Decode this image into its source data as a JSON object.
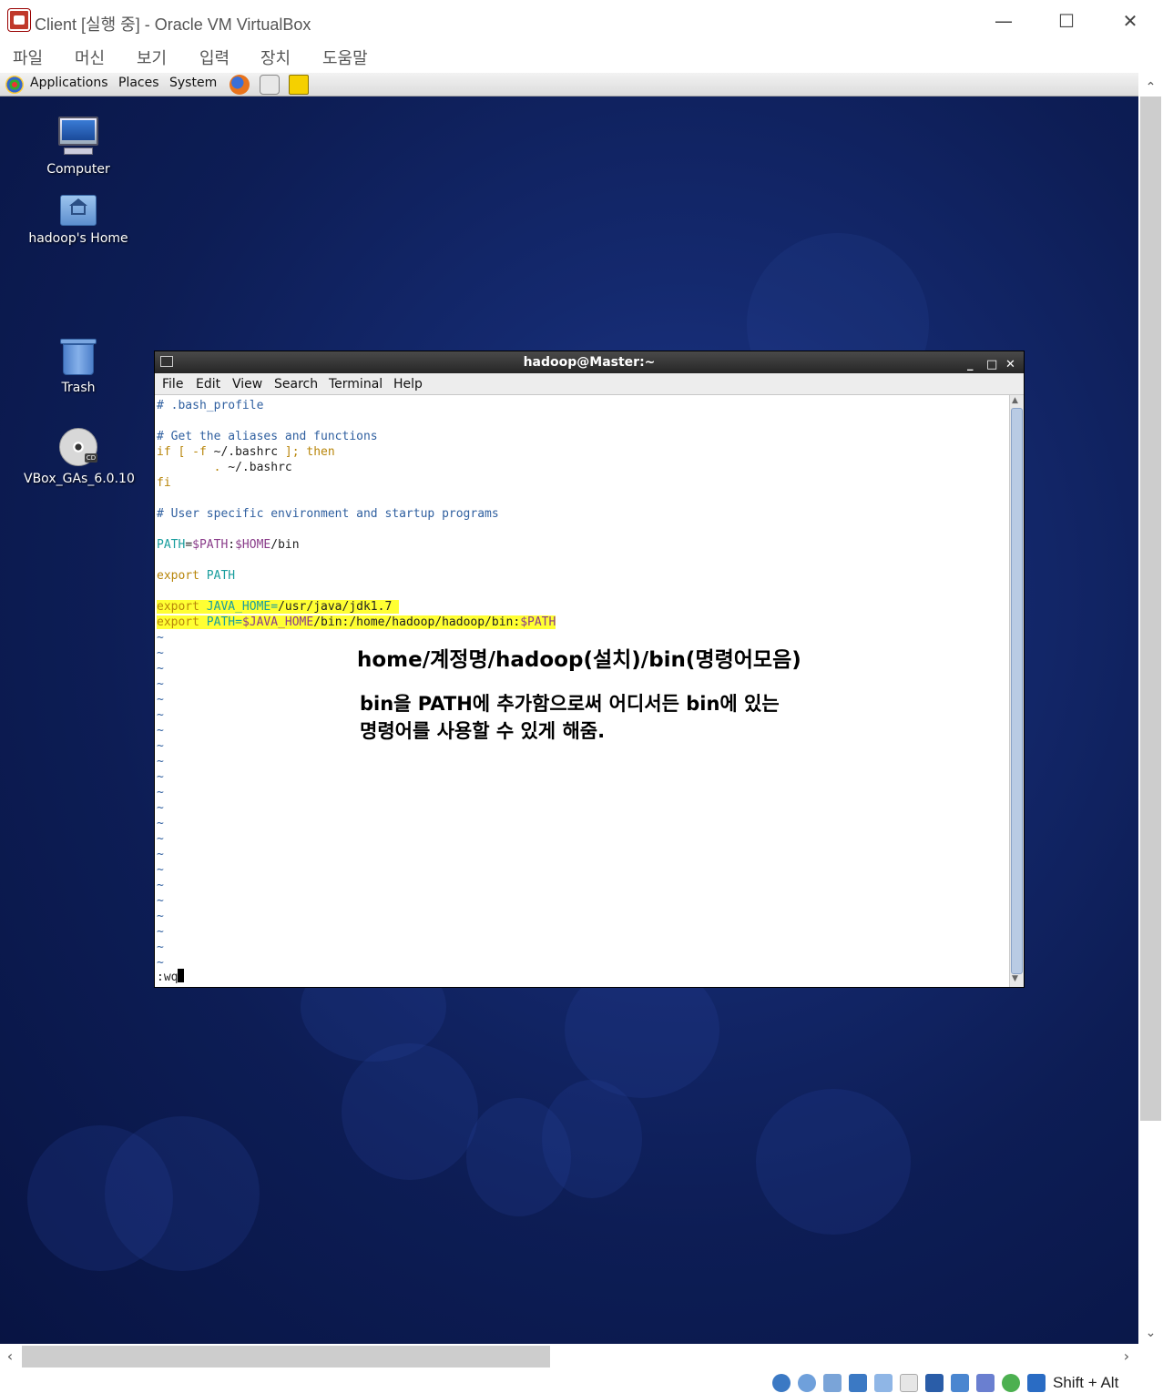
{
  "host": {
    "title": "Client [실행 중] - Oracle VM VirtualBox",
    "menu": [
      "파일",
      "머신",
      "보기",
      "입력",
      "장치",
      "도움말"
    ],
    "status_keys": "Shift + Alt"
  },
  "panel": {
    "applications": "Applications",
    "places": "Places",
    "system": "System"
  },
  "desktop": {
    "icons": [
      {
        "label": "Computer",
        "icon": "computer-icon"
      },
      {
        "label": "hadoop's Home",
        "icon": "home-folder-icon"
      },
      {
        "label": "Trash",
        "icon": "trash-icon"
      },
      {
        "label": "VBox_GAs_6.0.10",
        "icon": "cd-icon"
      }
    ]
  },
  "terminal": {
    "title": "hadoop@Master:~",
    "menu": [
      "File",
      "Edit",
      "View",
      "Search",
      "Terminal",
      "Help"
    ],
    "lines": {
      "l1": "# .bash_profile",
      "l3": "# Get the aliases and functions",
      "l4a": "if",
      "l4b": " [ -f ",
      "l4c": "~/.bashrc",
      "l4d": " ];",
      "l4e": " then",
      "l5a": "        . ",
      "l5b": "~/.bashrc",
      "l6": "fi",
      "l8": "# User specific environment and startup programs",
      "l10a": "PATH",
      "l10b": "=",
      "l10c": "$PATH",
      "l10d": ":",
      "l10e": "$HOME",
      "l10f": "/bin",
      "l12a": "export",
      "l12b": " PATH",
      "l14a": "export",
      "l14b": " JAVA_HOME=",
      "l14c": "/usr/java/jdk1.7",
      "l15a": "export",
      "l15b": " PATH=",
      "l15c": "$JAVA_HOME",
      "l15d": "/bin:/home/hadoop/hadoop/bin:",
      "l15e": "$PATH",
      "cmd": ":wq"
    },
    "tilde": "~"
  },
  "notes": {
    "line1": "home/계정명/hadoop(설치)/bin(명령어모음)",
    "line2a": "bin을 PATH에 추가함으로써 어디서든 bin에 있는",
    "line2b": "명령어를 사용할 수 있게 해줌."
  }
}
